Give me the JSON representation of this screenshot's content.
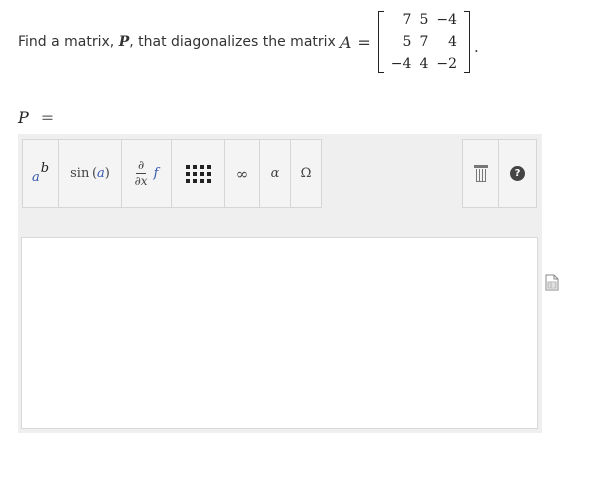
{
  "question": {
    "text_before": "Find a matrix, ",
    "var_p": "P",
    "text_middle": ", that diagonalizes the matrix ",
    "var_a": "A",
    "equals": "=",
    "period": ".",
    "matrix": [
      [
        "7",
        "5",
        "−4"
      ],
      [
        "5",
        "7",
        "4"
      ],
      [
        "−4",
        "4",
        "−2"
      ]
    ]
  },
  "answer_label": {
    "var": "P",
    "equals": "="
  },
  "toolbar": {
    "superscript": {
      "base": "a",
      "exp": "b",
      "icon": "superscript-icon"
    },
    "function": {
      "name": "sin",
      "open": "(",
      "arg": "a",
      "close": ")",
      "icon": "function-icon"
    },
    "derivative": {
      "num": "∂",
      "den": "∂x",
      "fn": "f",
      "icon": "derivative-icon"
    },
    "matrix": {
      "icon": "matrix-grid-icon"
    },
    "infinity": "∞",
    "alpha": "α",
    "omega": "Ω",
    "trash": {
      "icon": "trash-icon"
    },
    "help": {
      "label": "?",
      "icon": "help-icon"
    }
  },
  "answer_area": {
    "value": ""
  },
  "colors": {
    "editor_bg": "#efefef",
    "button_bg": "#f4f4f4",
    "variable_blue": "#3355aa"
  }
}
